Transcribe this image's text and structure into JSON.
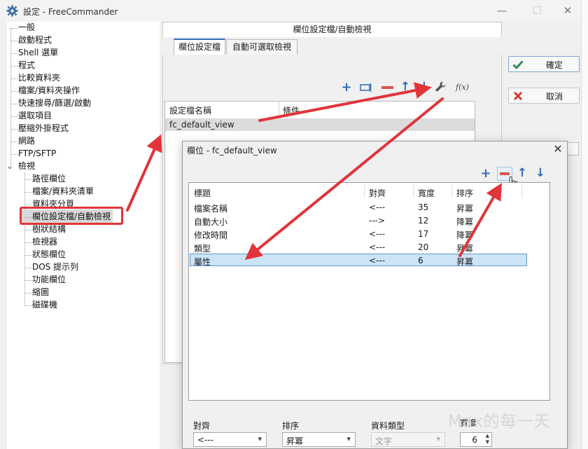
{
  "window": {
    "title": "設定 - FreeCommander",
    "minimize": "—",
    "maximize": "☐",
    "close": "✕"
  },
  "tree": {
    "items": [
      {
        "label": "一般"
      },
      {
        "label": "啟動程式"
      },
      {
        "label": "Shell 選單"
      },
      {
        "label": "程式"
      },
      {
        "label": "比較資料夾"
      },
      {
        "label": "檔案/資料夾操作"
      },
      {
        "label": "快速搜尋/篩選/啟動"
      },
      {
        "label": "選取項目"
      },
      {
        "label": "壓縮外掛程式"
      },
      {
        "label": "網路"
      },
      {
        "label": "FTP/SFTP"
      },
      {
        "label": "檢視",
        "expander": "⌄"
      }
    ],
    "children": [
      {
        "label": "路徑欄位"
      },
      {
        "label": "檔案/資料夾清單"
      },
      {
        "label": "資料夾分頁"
      },
      {
        "label": "欄位設定檔/自動檢視",
        "selected": true
      },
      {
        "label": "樹狀結構"
      },
      {
        "label": "檢視器"
      },
      {
        "label": "狀態欄位"
      },
      {
        "label": "DOS 提示列"
      },
      {
        "label": "功能欄位"
      },
      {
        "label": "縮圖"
      },
      {
        "label": "磁碟機"
      }
    ]
  },
  "panel": {
    "header": "欄位設定檔/自動檢視",
    "tabs": [
      {
        "label": "欄位設定檔",
        "active": true
      },
      {
        "label": "自動可選取檢視"
      }
    ],
    "toolbar_fx": "f(x)",
    "list_headers": {
      "name": "設定檔名稱",
      "condition": "條件"
    },
    "profiles": [
      {
        "name": "fc_default_view"
      }
    ]
  },
  "buttons": {
    "ok": "確定",
    "cancel": "取消"
  },
  "dialog": {
    "title": "欄位 - fc_default_view",
    "close": "✕",
    "headers": {
      "title": "標題",
      "align": "對齊",
      "width": "寬度",
      "sort": "排序"
    },
    "rows": [
      {
        "title": "檔案名稱",
        "align": "<---",
        "width": "35",
        "sort": "昇冪"
      },
      {
        "title": "自動大小",
        "align": "--->",
        "width": "12",
        "sort": "降冪"
      },
      {
        "title": "修改時間",
        "align": "<---",
        "width": "17",
        "sort": "降冪"
      },
      {
        "title": "類型",
        "align": "<---",
        "width": "20",
        "sort": "昇冪"
      },
      {
        "title": "屬性",
        "align": "<---",
        "width": "6",
        "sort": "昇冪",
        "selected": true
      }
    ],
    "fields": {
      "align_label": "對齊",
      "align_value": "<---",
      "sort_label": "排序",
      "sort_value": "昇冪",
      "type_label": "資料類型",
      "type_value": "文字",
      "width_label": "寬度",
      "width_value": "6"
    }
  },
  "watermark": "Max的每一天",
  "colors": {
    "accent": "#2f6db5",
    "annotation": "#e0353a",
    "remove": "#d9534f",
    "selection": "#cde4f7"
  }
}
